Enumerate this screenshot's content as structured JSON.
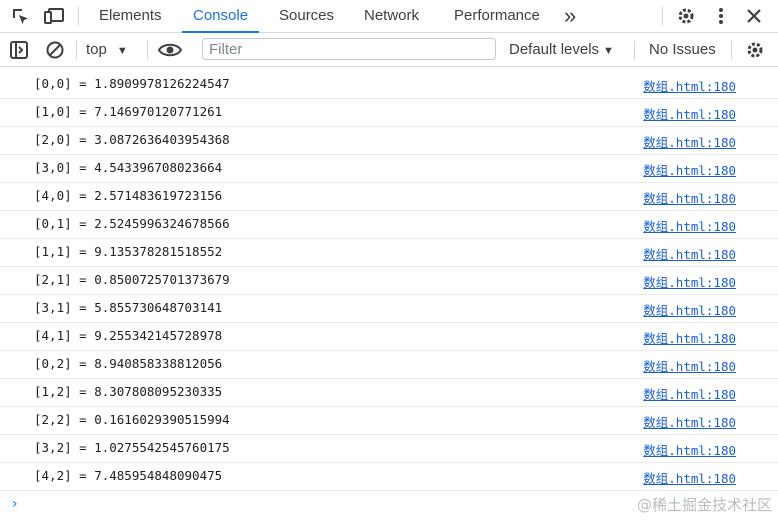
{
  "tabs": {
    "items": [
      "Elements",
      "Console",
      "Sources",
      "Network",
      "Performance"
    ],
    "active": "Console",
    "more": "»"
  },
  "toolbar": {
    "context": "top",
    "filter_placeholder": "Filter",
    "filter_value": "",
    "levels": "Default levels",
    "issues": "No Issues"
  },
  "console": {
    "entries": [
      {
        "text": "[0,0] = 1.8909978126224547",
        "source": "数组.html:180"
      },
      {
        "text": "[1,0] = 7.146970120771261",
        "source": "数组.html:180"
      },
      {
        "text": "[2,0] = 3.0872636403954368",
        "source": "数组.html:180"
      },
      {
        "text": "[3,0] = 4.543396708023664",
        "source": "数组.html:180"
      },
      {
        "text": "[4,0] = 2.571483619723156",
        "source": "数组.html:180"
      },
      {
        "text": "[0,1] = 2.5245996324678566",
        "source": "数组.html:180"
      },
      {
        "text": "[1,1] = 9.135378281518552",
        "source": "数组.html:180"
      },
      {
        "text": "[2,1] = 0.8500725701373679",
        "source": "数组.html:180"
      },
      {
        "text": "[3,1] = 5.855730648703141",
        "source": "数组.html:180"
      },
      {
        "text": "[4,1] = 9.255342145728978",
        "source": "数组.html:180"
      },
      {
        "text": "[0,2] = 8.940858338812056",
        "source": "数组.html:180"
      },
      {
        "text": "[1,2] = 8.307808095230335",
        "source": "数组.html:180"
      },
      {
        "text": "[2,2] = 0.1616029390515994",
        "source": "数组.html:180"
      },
      {
        "text": "[3,2] = 1.0275542545760175",
        "source": "数组.html:180"
      },
      {
        "text": "[4,2] = 7.485954848090475",
        "source": "数组.html:180"
      }
    ],
    "prompt": "›"
  },
  "watermark": "@稀土掘金技术社区",
  "colors": {
    "accent": "#1a73e8",
    "link": "#1a5fd4",
    "divider": "#e8eaed"
  }
}
